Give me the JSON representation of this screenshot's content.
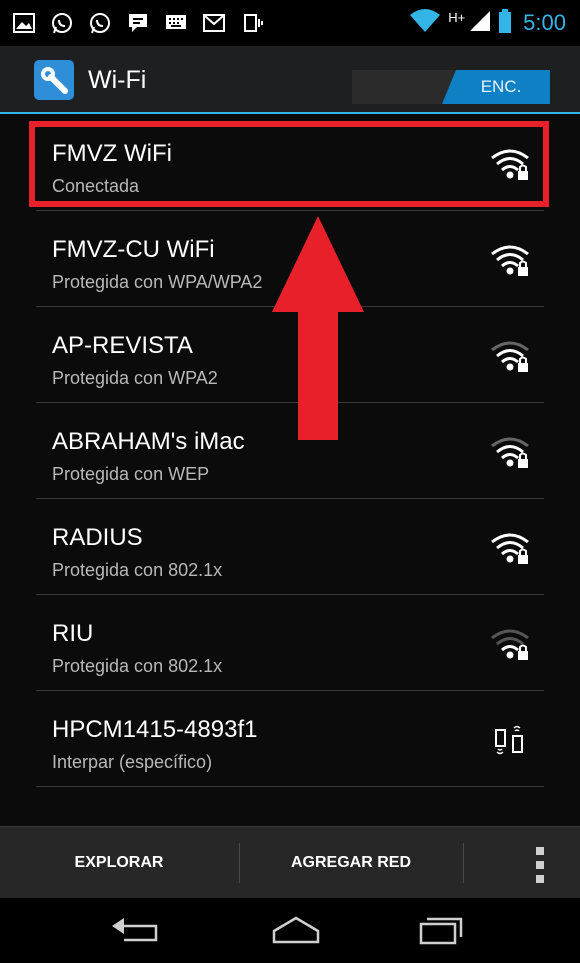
{
  "status_bar": {
    "network_type": "H+",
    "time": "5:00",
    "icons": [
      "gallery-icon",
      "whatsapp-icon",
      "whatsapp-icon",
      "chat-icon",
      "keyboard-icon",
      "gmail-icon",
      "vibrate-icon",
      "wifi-icon",
      "signal-icon",
      "battery-icon"
    ],
    "accent_color": "#33b5e5"
  },
  "action_bar": {
    "title": "Wi-Fi",
    "toggle_label": "ENC.",
    "icon": "settings-wrench-icon"
  },
  "networks": [
    {
      "name": "FMVZ WiFi",
      "status": "Conectada",
      "icon": "wifi-locked-icon",
      "signal": "strong"
    },
    {
      "name": "FMVZ-CU WiFi",
      "status": "Protegida con WPA/WPA2",
      "icon": "wifi-locked-icon",
      "signal": "strong"
    },
    {
      "name": "AP-REVISTA",
      "status": "Protegida con WPA2",
      "icon": "wifi-locked-icon",
      "signal": "medium"
    },
    {
      "name": "ABRAHAM's iMac",
      "status": "Protegida con WEP",
      "icon": "wifi-locked-icon",
      "signal": "medium"
    },
    {
      "name": "RADIUS",
      "status": "Protegida con 802.1x",
      "icon": "wifi-locked-icon",
      "signal": "strong"
    },
    {
      "name": "RIU",
      "status": "Protegida con 802.1x",
      "icon": "wifi-locked-icon",
      "signal": "weak"
    },
    {
      "name": "HPCM1415-4893f1",
      "status": "Interpar (específico)",
      "icon": "wifi-direct-icon",
      "signal": "none"
    }
  ],
  "annotation": {
    "highlight_color": "#e8202a",
    "arrow": "up-arrow"
  },
  "bottom_bar": {
    "explore_label": "EXPLORAR",
    "add_network_label": "AGREGAR RED"
  },
  "nav_bar": {
    "icons": [
      "back-icon",
      "home-icon",
      "recents-icon"
    ]
  }
}
